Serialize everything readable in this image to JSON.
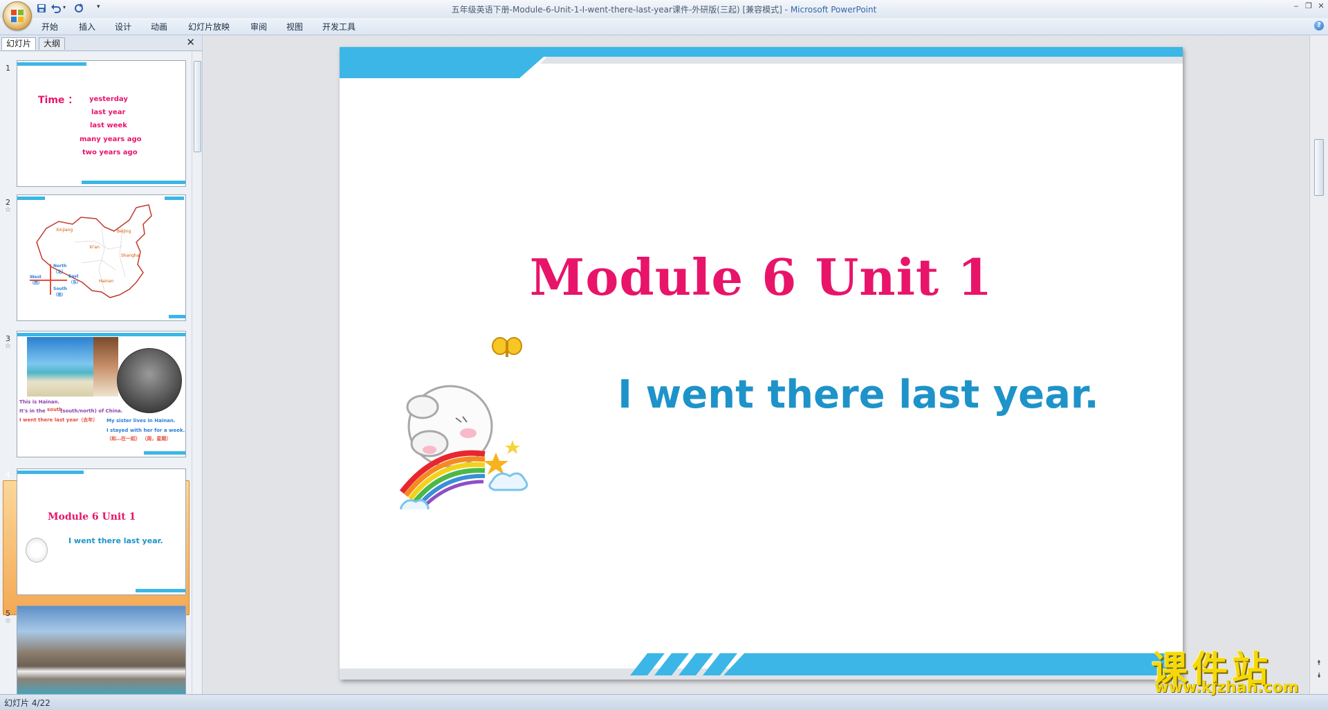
{
  "window": {
    "title": "五年级英语下册-Module-6-Unit-1-I-went-there-last-year课件-外研版(三起) [兼容模式]",
    "title_sep": " - ",
    "app_name": "Microsoft PowerPoint"
  },
  "ribbon": {
    "tabs": [
      "开始",
      "插入",
      "设计",
      "动画",
      "幻灯片放映",
      "审阅",
      "视图",
      "开发工具"
    ]
  },
  "left_pane": {
    "tabs": [
      "幻灯片",
      "大纲"
    ]
  },
  "thumbnails": [
    {
      "number": "1",
      "time_label": "Time ：",
      "time_items": [
        "yesterday",
        "last year",
        "last week",
        "many years ago",
        "two years ago"
      ]
    },
    {
      "number": "2",
      "map_labels": [
        "Xinjiang",
        "Beijing",
        "Xi'an",
        "Shanghai",
        "Hainan"
      ],
      "compass": {
        "north": "North",
        "north_cn": "（北）",
        "west": "West",
        "west_cn": "（西）",
        "east": "East",
        "east_cn": "（东）",
        "south": "South",
        "south_cn": "（南）"
      }
    },
    {
      "number": "3",
      "lines": [
        "This is Hainan.",
        "It's in the",
        "south",
        "(south/north)  of  China.",
        "I went there last year（去年）",
        "My sister lives  in Hainan.",
        "I stayed with her for a week.",
        "（和…在一起）    （周，星期）"
      ]
    },
    {
      "number": "4",
      "title": "Module 6 Unit 1",
      "subtitle": "I went there last year."
    },
    {
      "number": "5"
    }
  ],
  "slide": {
    "title": "Module 6 Unit 1",
    "subtitle": "I went there last year."
  },
  "status": {
    "text": "幻灯片 4/22"
  },
  "watermark": {
    "cn": "课件站",
    "url": "www.kjzhan.com"
  },
  "colors": {
    "accent_blue": "#3bb6e6",
    "title_pink": "#e8146a",
    "subtitle_blue": "#1e93c9",
    "selection_orange": "#f4a953"
  }
}
